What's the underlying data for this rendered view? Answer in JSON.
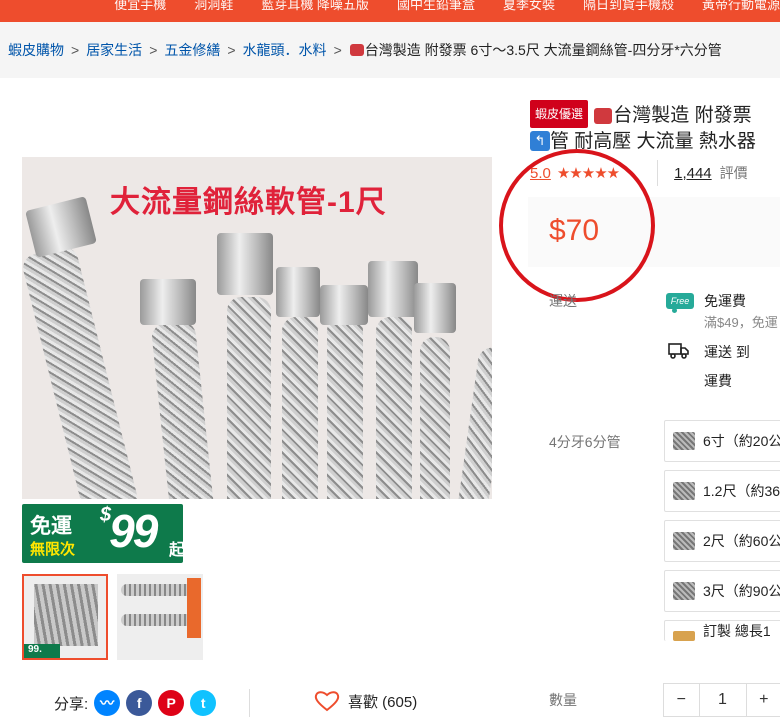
{
  "topbar": {
    "links": [
      "便宜手機",
      "洞洞鞋",
      "藍芽耳機 降噪五版",
      "國中生鉛筆盒",
      "夏季女裝",
      "隔日到貨手機殼",
      "黃帝行動電源"
    ]
  },
  "breadcrumb": {
    "items": [
      "蝦皮購物",
      "居家生活",
      "五金修繕",
      "水龍頭．水料"
    ],
    "current": "台灣製造 附發票 6寸～3.5尺 大流量鋼絲管-四分牙*六分管"
  },
  "gallery": {
    "image_caption": "大流量鋼絲軟管-1尺",
    "banner": {
      "line1": "免運",
      "line2": "無限次",
      "currency": "$",
      "amount": "99",
      "suffix": "起"
    },
    "thumb_overlay": "99."
  },
  "share": {
    "label": "分享:",
    "icons": [
      "messenger-icon",
      "facebook-icon",
      "pinterest-icon",
      "twitter-icon"
    ]
  },
  "like": {
    "label": "喜歡 (605)"
  },
  "product": {
    "badge": "蝦皮優選",
    "title_line1": "台灣製造 附發票",
    "title_line2": "管 耐高壓 大流量 熱水器",
    "rating": "5.0",
    "stars": "★★★★★",
    "rating_count": "1,444",
    "rating_label": "評價",
    "price": "$70"
  },
  "shipping": {
    "label": "運送",
    "free_badge": "Free",
    "free_title": "免運費",
    "free_sub": "滿$49，免運",
    "to_label": "運送 到",
    "fee_label": "運費"
  },
  "variants": {
    "label": "4分牙6分管",
    "options": [
      "6寸（約20公",
      "1.2尺（約36",
      "2尺（約60公",
      "3尺（約90公",
      "訂製 總長1"
    ]
  },
  "quantity": {
    "label": "數量",
    "minus": "−",
    "value": "1",
    "plus": "+"
  },
  "colors": {
    "brand": "#ee4d2d",
    "annotation": "#d9141b",
    "banner": "#0e7a4b"
  }
}
